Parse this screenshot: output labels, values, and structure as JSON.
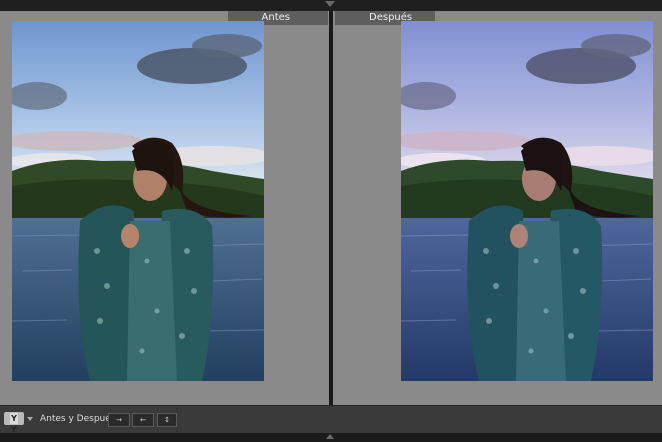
{
  "panes": {
    "before_label": "Antes",
    "after_label": "Después"
  },
  "toolbar": {
    "view_mode_label": "Y Y",
    "compare_label": "Antes y Después:",
    "copy_before_to_after": "→",
    "copy_after_to_before": "←",
    "swap": "↕"
  },
  "colors": {
    "panel_gray": "#8a8a8a",
    "toolbar": "#3a3a3a",
    "label_bg": "#5e5e5e"
  }
}
